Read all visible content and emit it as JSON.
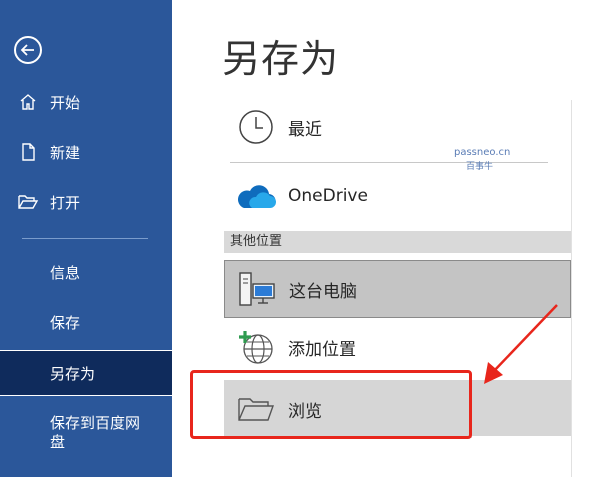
{
  "sidebar": {
    "items": [
      {
        "label": "开始",
        "icon": "home-icon"
      },
      {
        "label": "新建",
        "icon": "new-document-icon"
      },
      {
        "label": "打开",
        "icon": "open-folder-icon"
      },
      {
        "label": "信息"
      },
      {
        "label": "保存"
      },
      {
        "label": "另存为",
        "active": true
      },
      {
        "label": "保存到百度网盘"
      }
    ]
  },
  "main": {
    "title": "另存为",
    "recent_label": "最近",
    "onedrive_label": "OneDrive",
    "other_locations_label": "其他位置",
    "this_pc_label": "这台电脑",
    "add_location_label": "添加位置",
    "browse_label": "浏览"
  },
  "watermark": {
    "line1": "passneo.cn",
    "line2": "百事牛"
  },
  "colors": {
    "sidebar_bg": "#2b579a",
    "sidebar_active": "#0f2b5c",
    "annotation_red": "#e8261c"
  }
}
